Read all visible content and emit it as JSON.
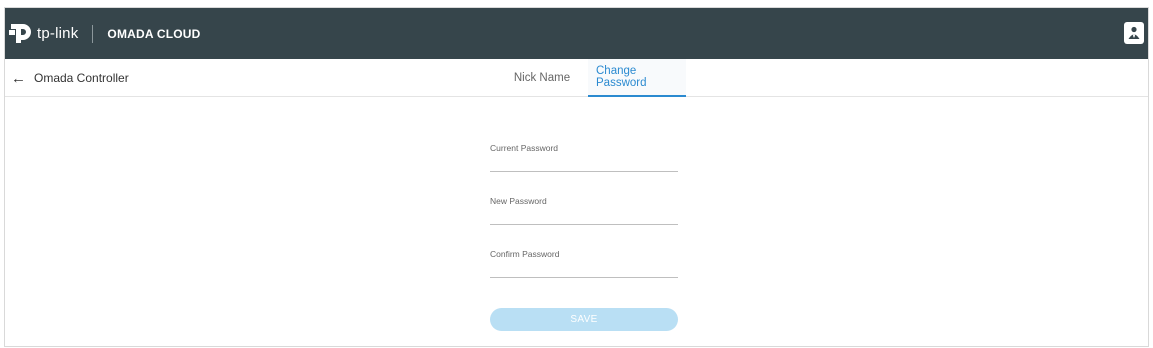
{
  "header": {
    "brand": "tp-link",
    "product": "OMADA CLOUD",
    "user_icon": "user-icon",
    "colors": {
      "background": "#36454b",
      "text": "#ffffff"
    }
  },
  "nav": {
    "back_label": "Omada Controller",
    "back_icon": "arrow-left-icon",
    "tabs": [
      {
        "label": "Nick Name",
        "active": false
      },
      {
        "label": "Change Password",
        "active": true
      }
    ],
    "active_color": "#2b8ad0"
  },
  "form": {
    "fields": [
      {
        "label": "Current Password",
        "value": ""
      },
      {
        "label": "New Password",
        "value": ""
      },
      {
        "label": "Confirm Password",
        "value": ""
      }
    ],
    "save_label": "SAVE",
    "save_color": "#b9dff4"
  }
}
